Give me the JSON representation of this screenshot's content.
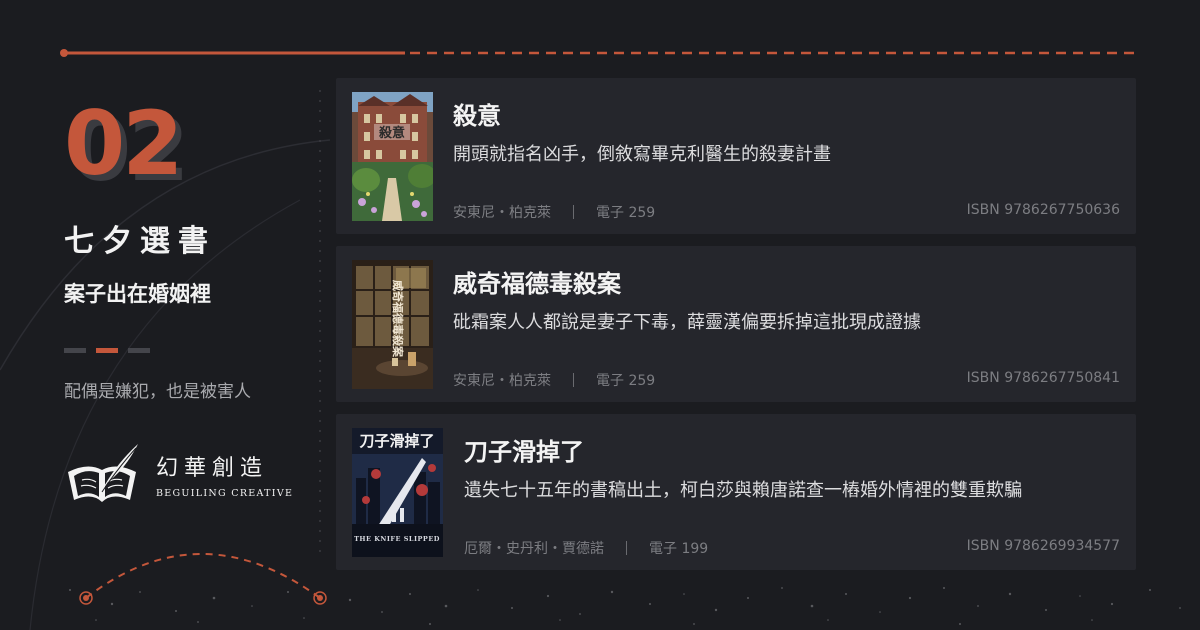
{
  "colors": {
    "background": "#1b1c20",
    "accent": "#c4573b",
    "card": "#25262c",
    "muted": "#7c7d82"
  },
  "issue": {
    "number": "02",
    "series_title": "七夕選書",
    "subtitle": "案子出在婚姻裡",
    "tagline": "配偶是嫌犯，也是被害人"
  },
  "publisher": {
    "name_zh": "幻華創造",
    "name_en": "BEGUILING CREATIVE",
    "logo_icon": "open-book-feather-icon"
  },
  "books": [
    {
      "title": "殺意",
      "description": "開頭就指名凶手，倒敘寫畢克利醫生的殺妻計畫",
      "author": "安東尼・柏克萊",
      "price": "電子 259",
      "isbn": "ISBN 9786267750636",
      "cover_text": "殺意",
      "cover_icon": "mansion-garden-cover"
    },
    {
      "title": "威奇福德毒殺案",
      "description": "砒霜案人人都說是妻子下毒，薛靈漢偏要拆掉這批現成證據",
      "author": "安東尼・柏克萊",
      "price": "電子 259",
      "isbn": "ISBN 9786267750841",
      "cover_text": "威奇福德毒殺案",
      "cover_icon": "cafe-window-cover"
    },
    {
      "title": "刀子滑掉了",
      "description": "遺失七十五年的書稿出土，柯白莎與賴唐諾查一樁婚外情裡的雙重欺騙",
      "author": "厄爾・史丹利・賈德諾",
      "price": "電子 199",
      "isbn": "ISBN 9786269934577",
      "cover_text": "刀子滑掉了",
      "cover_subtext": "THE KNIFE SLIPPED",
      "cover_icon": "knife-city-cover"
    }
  ]
}
